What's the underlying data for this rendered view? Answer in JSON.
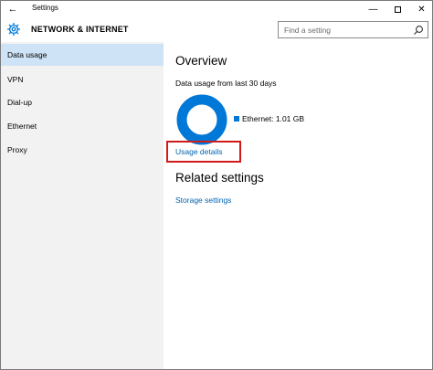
{
  "window": {
    "title": "Settings",
    "back_glyph": "←",
    "minimize_glyph": "—",
    "close_glyph": "✕"
  },
  "header": {
    "title": "NETWORK & INTERNET",
    "icon": "gear-icon",
    "search_placeholder": "Find a setting",
    "search_icon": "search-icon"
  },
  "sidebar": {
    "items": [
      {
        "label": "Data usage",
        "selected": true
      },
      {
        "label": "VPN",
        "selected": false
      },
      {
        "label": "Dial-up",
        "selected": false
      },
      {
        "label": "Ethernet",
        "selected": false
      },
      {
        "label": "Proxy",
        "selected": false
      }
    ]
  },
  "main": {
    "overview_title": "Overview",
    "usage_caption": "Data usage from last 30 days",
    "legend": "Ethernet: 1.01 GB",
    "ethernet_share": 1.0,
    "details_link": "Usage details",
    "related_title": "Related settings",
    "storage_link": "Storage settings"
  },
  "colors": {
    "accent": "#0078d7",
    "link": "#0063b1",
    "highlight_box": "#d11a1a",
    "sidebar_bg": "#f2f2f2",
    "selected_bg": "#cfe3f6"
  }
}
